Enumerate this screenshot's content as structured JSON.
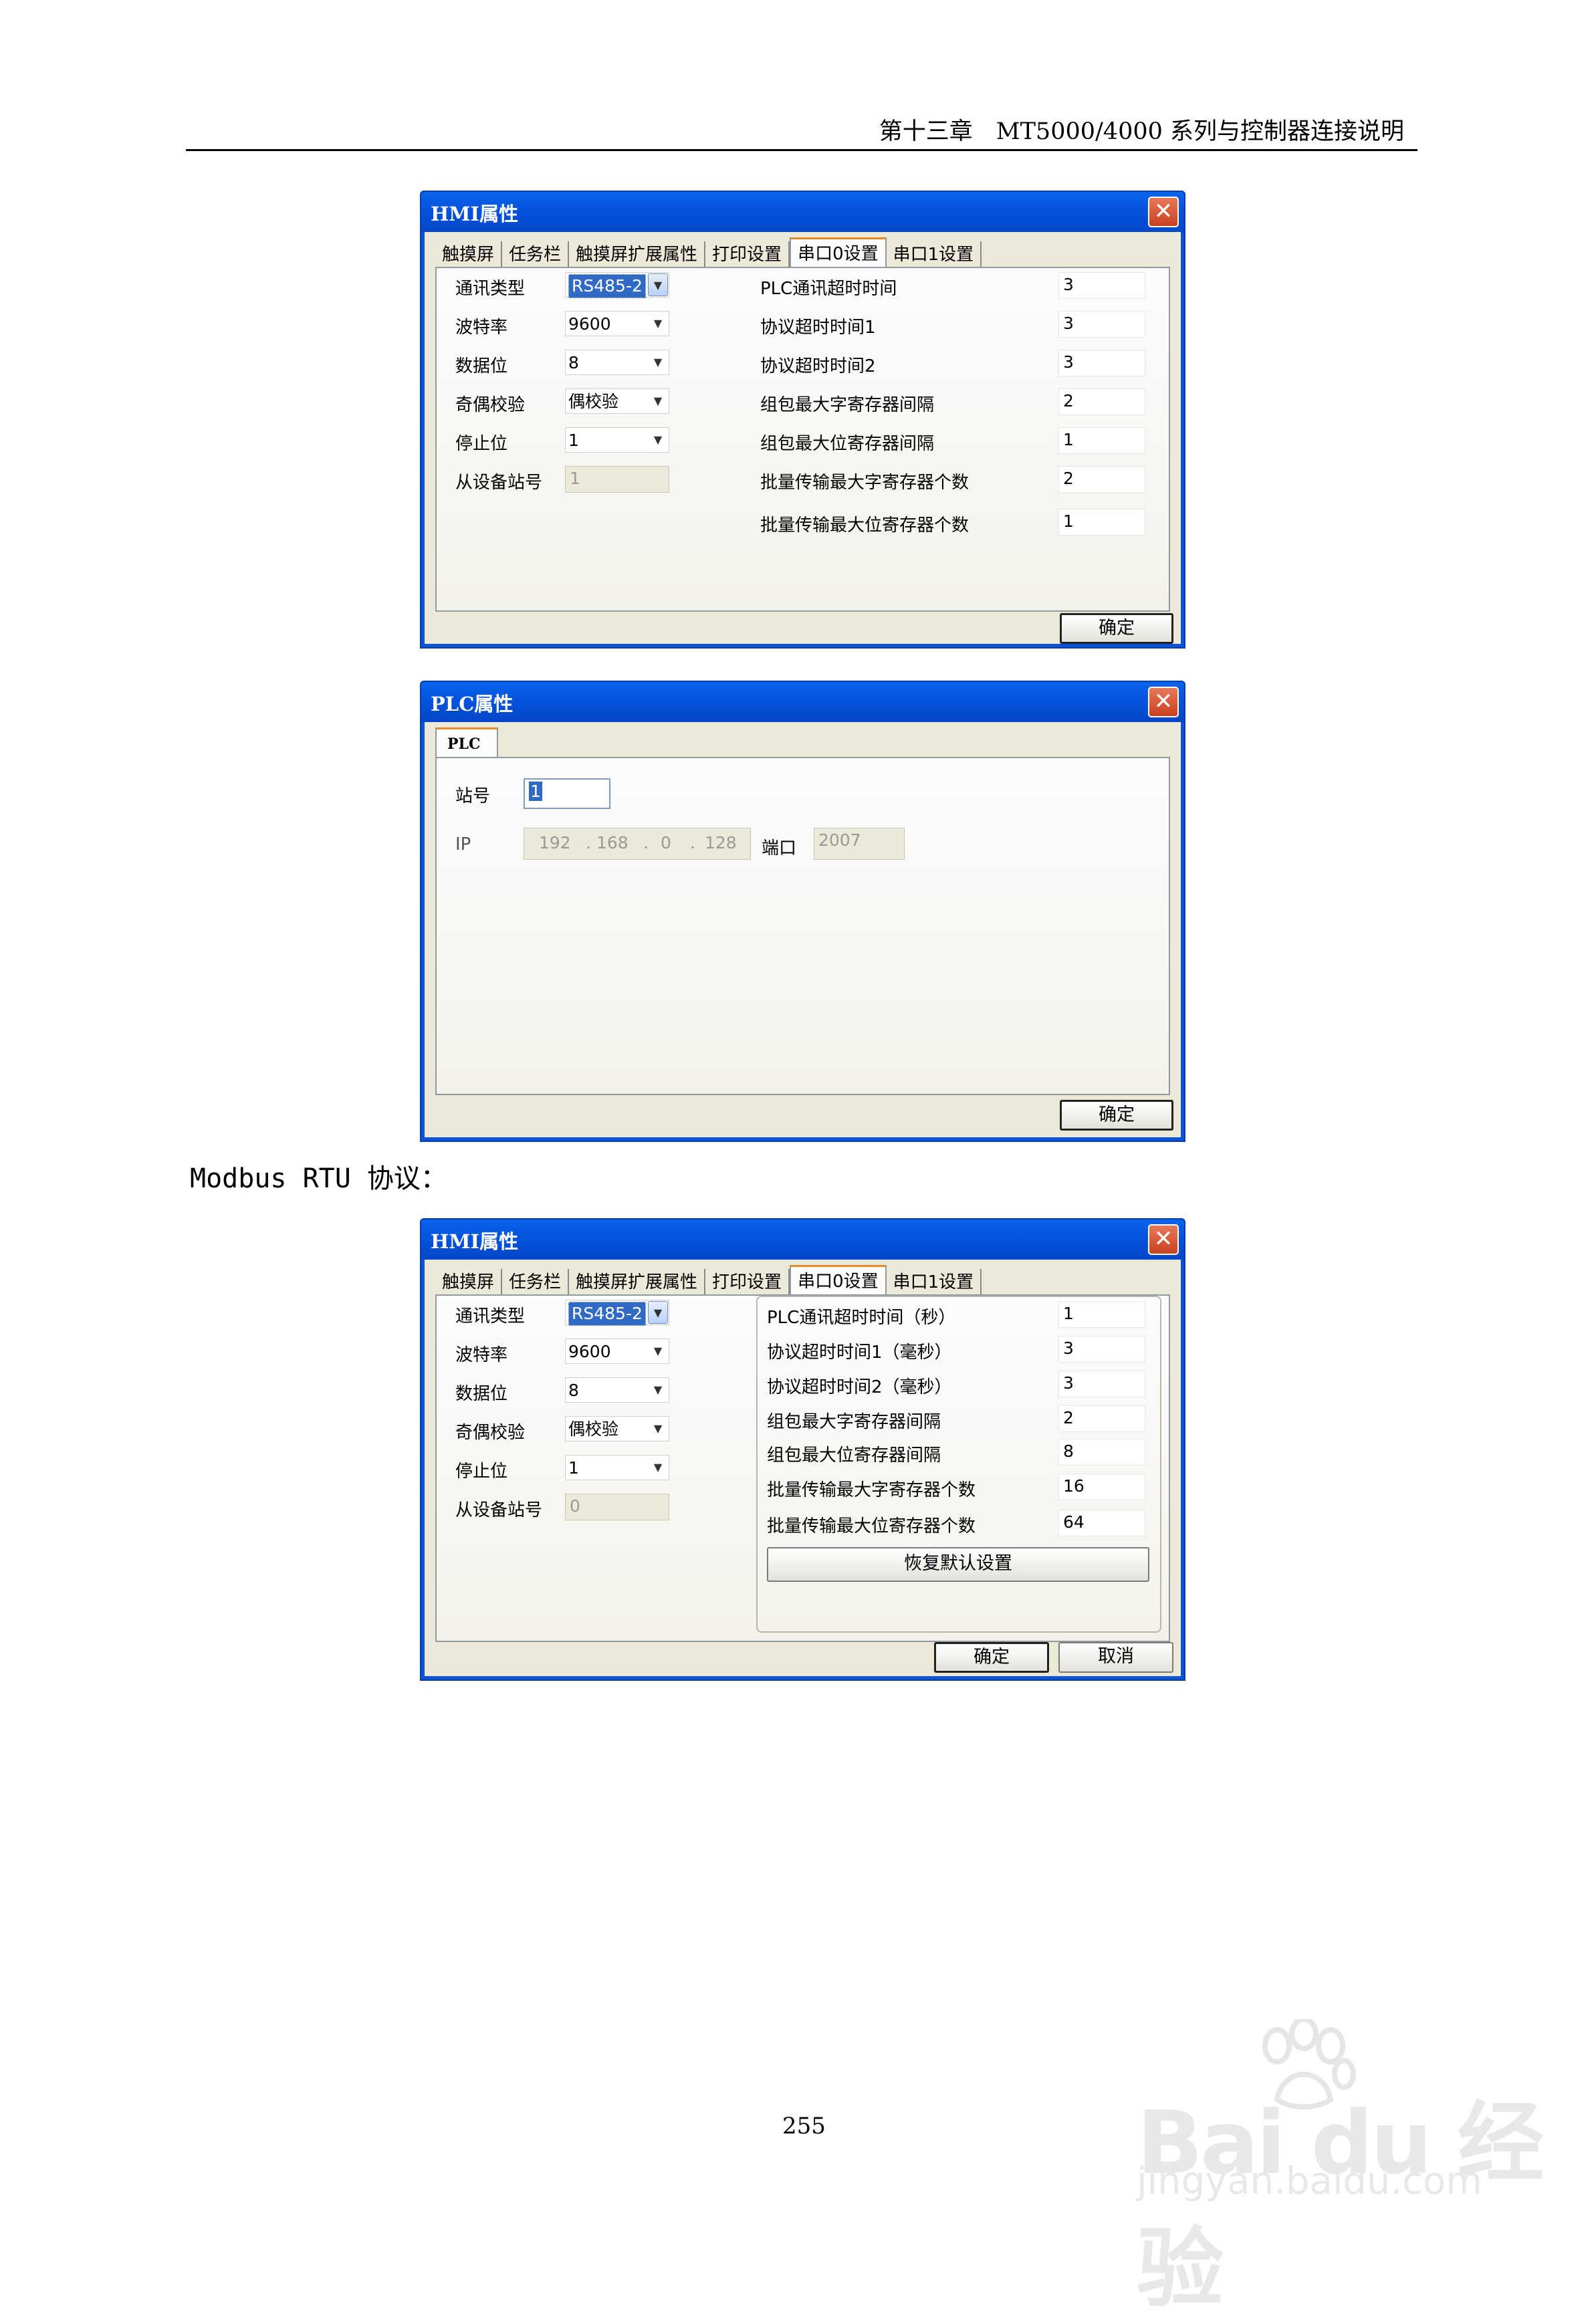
{
  "header": {
    "text": "第十三章　MT5000/4000 系列与控制器连接说明"
  },
  "dialog1": {
    "title": "HMI属性",
    "tabs": [
      "触摸屏",
      "任务栏",
      "触摸屏扩展属性",
      "打印设置",
      "串口0设置",
      "串口1设置"
    ],
    "left_labels": [
      "通讯类型",
      "波特率",
      "数据位",
      "奇偶校验",
      "停止位",
      "从设备站号"
    ],
    "left_values": [
      "RS485-2",
      "9600",
      "8",
      "偶校验",
      "1",
      "1"
    ],
    "right_labels": [
      "PLC通讯超时时间",
      "协议超时时间1",
      "协议超时时间2",
      "组包最大字寄存器间隔",
      "组包最大位寄存器间隔",
      "批量传输最大字寄存器个数",
      "批量传输最大位寄存器个数"
    ],
    "right_values": [
      "3",
      "3",
      "3",
      "2",
      "1",
      "2",
      "1"
    ],
    "ok": "确定"
  },
  "dialog2": {
    "title": "PLC属性",
    "tab": "PLC",
    "station_label": "站号",
    "station_value": "1",
    "ip_label": "IP",
    "ip_parts": [
      "192",
      "168",
      "0",
      "128"
    ],
    "port_label": "端口",
    "port_value": "2007",
    "ok": "确定"
  },
  "section_title": "Modbus RTU 协议：",
  "dialog3": {
    "title": "HMI属性",
    "tabs": [
      "触摸屏",
      "任务栏",
      "触摸屏扩展属性",
      "打印设置",
      "串口0设置",
      "串口1设置"
    ],
    "left_labels": [
      "通讯类型",
      "波特率",
      "数据位",
      "奇偶校验",
      "停止位",
      "从设备站号"
    ],
    "left_values": [
      "RS485-2",
      "9600",
      "8",
      "偶校验",
      "1",
      "0"
    ],
    "right_labels": [
      "PLC通讯超时时间（秒）",
      "协议超时时间1（毫秒）",
      "协议超时时间2（毫秒）",
      "组包最大字寄存器间隔",
      "组包最大位寄存器间隔",
      "批量传输最大字寄存器个数",
      "批量传输最大位寄存器个数"
    ],
    "right_values": [
      "1",
      "3",
      "3",
      "2",
      "8",
      "16",
      "64"
    ],
    "restore": "恢复默认设置",
    "ok": "确定",
    "cancel": "取消"
  },
  "page_number": "255",
  "watermark": {
    "brand": "Bai du 经验",
    "url": "jingyan.baidu.com"
  }
}
